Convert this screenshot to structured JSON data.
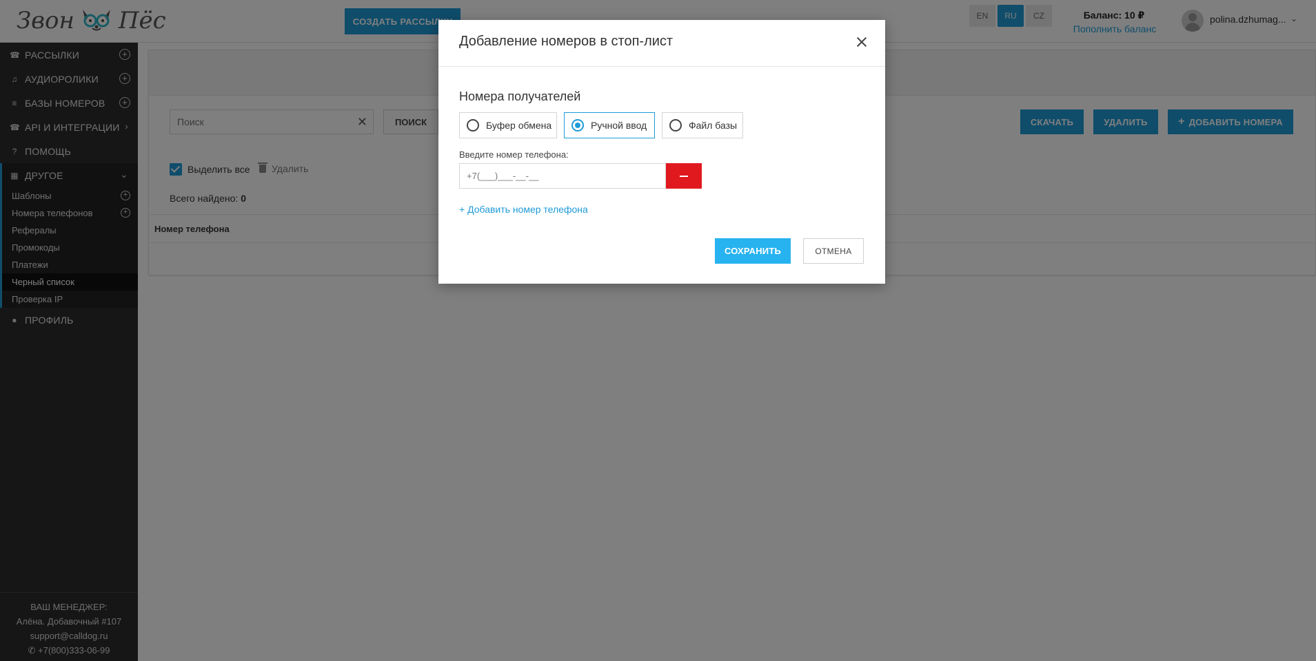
{
  "header": {
    "logo_text_left": "Звон",
    "logo_text_right": "Пёс",
    "create_button": "СОЗДАТЬ РАССЫЛКУ",
    "languages": [
      {
        "code": "EN",
        "active": false
      },
      {
        "code": "RU",
        "active": true
      },
      {
        "code": "CZ",
        "active": false
      }
    ],
    "balance": "Баланс: 10 ₽",
    "topup_link": "Пополнить баланс",
    "user_name": "polina.dzhumag...",
    "accent_color": "#1e9bd7"
  },
  "sidebar": {
    "items": [
      {
        "label": "РАССЫЛКИ",
        "icon": "phone-icon"
      },
      {
        "label": "АУДИОРОЛИКИ",
        "icon": "audio-icon"
      },
      {
        "label": "БАЗЫ НОМЕРОВ",
        "icon": "database-icon"
      },
      {
        "label": "API И ИНТЕГРАЦИИ",
        "icon": "phone-icon"
      },
      {
        "label": "ПОМОЩЬ",
        "icon": "help-icon"
      },
      {
        "label": "ДРУГОЕ",
        "icon": "grid-icon"
      },
      {
        "label": "ПРОФИЛЬ",
        "icon": "user-icon"
      }
    ],
    "sub_items": [
      {
        "label": "Шаблоны"
      },
      {
        "label": "Номера телефонов"
      },
      {
        "label": "Рефералы"
      },
      {
        "label": "Промокоды"
      },
      {
        "label": "Платежи"
      },
      {
        "label": "Черный список"
      },
      {
        "label": "Проверка IP"
      }
    ],
    "manager": {
      "title": "ВАШ МЕНЕДЖЕР:",
      "name": "Алёна. Добавочный #107",
      "email": "support@calldog.ru",
      "phone": "+7(800)333-06-99"
    }
  },
  "main": {
    "search_placeholder": "Поиск",
    "search_button": "ПОИСК",
    "download_button": "СКАЧАТЬ",
    "delete_button": "УДАЛИТЬ",
    "add_numbers_button": "ДОБАВИТЬ НОМЕРА",
    "select_all": "Выделить все",
    "delete_small": "Удалить",
    "found_label": "Всего найдено:",
    "found_count": "0",
    "column_phone": "Номер телефона"
  },
  "modal": {
    "title": "Добавление номеров в стоп-лист",
    "section_label": "Номера получателей",
    "options": [
      {
        "label": "Буфер обмена",
        "selected": false
      },
      {
        "label": "Ручной ввод",
        "selected": true
      },
      {
        "label": "Файл базы",
        "selected": false
      }
    ],
    "field_label": "Введите номер телефона:",
    "phone_placeholder": "+7(___)___-__-__",
    "add_phone_link": "+ Добавить номер телефона",
    "save_button": "СОХРАНИТЬ",
    "cancel_button": "ОТМЕНА",
    "remove_color": "#e0191f"
  }
}
